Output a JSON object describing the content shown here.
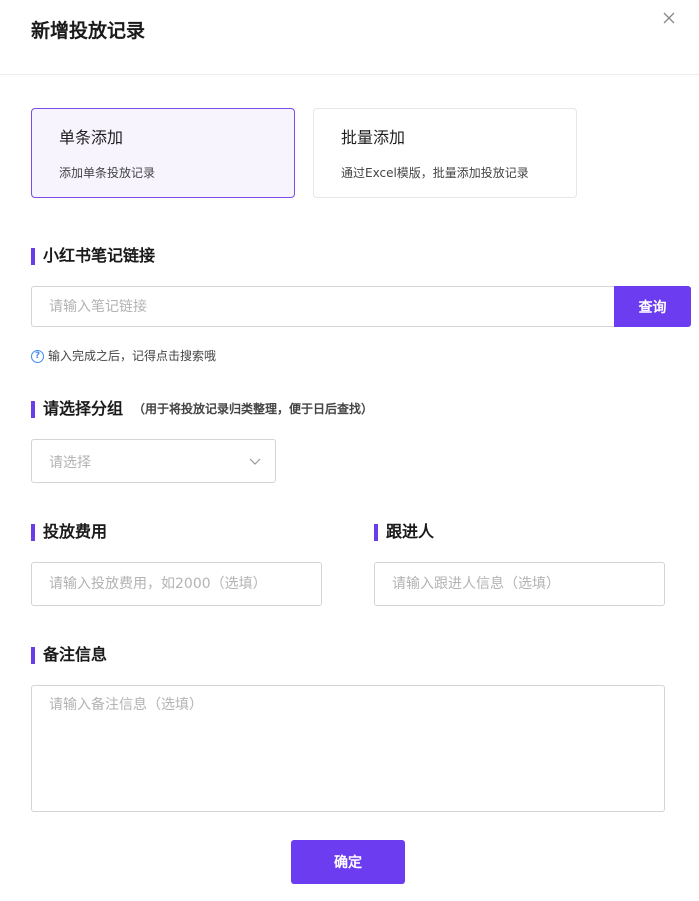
{
  "dialog": {
    "title": "新增投放记录"
  },
  "modes": [
    {
      "title": "单条添加",
      "desc": "添加单条投放记录",
      "active": true
    },
    {
      "title": "批量添加",
      "desc": "通过Excel模版，批量添加投放记录",
      "active": false
    }
  ],
  "note_link": {
    "label": "小红书笔记链接",
    "placeholder": "请输入笔记链接",
    "query_label": "查询",
    "tip": "输入完成之后，记得点击搜索哦"
  },
  "group": {
    "label": "请选择分组",
    "hint": "（用于将投放记录归类整理，便于日后查找）",
    "placeholder": "请选择"
  },
  "cost": {
    "label": "投放费用",
    "placeholder": "请输入投放费用，如2000（选填）"
  },
  "follower": {
    "label": "跟进人",
    "placeholder": "请输入跟进人信息（选填）"
  },
  "remark": {
    "label": "备注信息",
    "placeholder": "请输入备注信息（选填）"
  },
  "confirm_label": "确定",
  "colors": {
    "accent": "#6b3cf0",
    "active_card_bg": "#f7f4fe",
    "active_card_border": "#7b4ce8",
    "tip_icon": "#3d8bf0"
  },
  "icons": {
    "close": "close-icon",
    "help": "question-circle-icon",
    "dropdown": "chevron-down-icon"
  }
}
